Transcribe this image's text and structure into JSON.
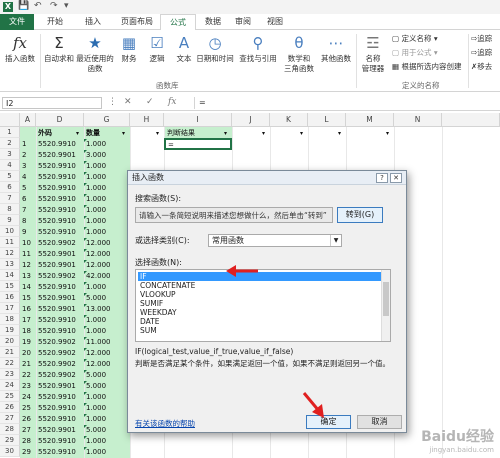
{
  "tabs": [
    "文件",
    "开始",
    "插入",
    "页面布局",
    "公式",
    "数据",
    "审阅",
    "视图"
  ],
  "ribbon": {
    "insert_function": "插入函数",
    "autosum": "自动求和",
    "recent": [
      "最近使用的",
      "函数"
    ],
    "financial": "财务",
    "logical": "逻辑",
    "text": "文本",
    "datetime": "日期和时间",
    "lookup": "查找与引用",
    "math": [
      "数学和",
      "三角函数"
    ],
    "other": "其他函数",
    "group_library": "函数库",
    "name_manager": [
      "名称",
      "管理器"
    ],
    "define_name": "定义名称",
    "use_in_formula": "用于公式",
    "create_from_selection": "根据所选内容创建",
    "group_defined_names": "定义的名称",
    "trace_precedents": "追踪",
    "trace_dependents": "追踪",
    "remove_arrows": "移去"
  },
  "formula_bar": {
    "name_box": "I2",
    "content": "="
  },
  "columns": [
    "A",
    "D",
    "G",
    "H",
    "I",
    "J",
    "K",
    "L",
    "M",
    "N"
  ],
  "header_row": {
    "col_d": "外码",
    "col_g": "数量",
    "col_i": "判断结果"
  },
  "rows": [
    {
      "n": "1",
      "a": "",
      "d": "",
      "g": ""
    },
    {
      "n": "2",
      "a": "1",
      "d": "5520.9910",
      "g": "1.000",
      "i": "="
    },
    {
      "n": "3",
      "a": "2",
      "d": "5520.9901",
      "g": "3.000"
    },
    {
      "n": "4",
      "a": "3",
      "d": "5520.9910",
      "g": "1.000"
    },
    {
      "n": "5",
      "a": "4",
      "d": "5520.9910",
      "g": "1.000"
    },
    {
      "n": "6",
      "a": "5",
      "d": "5520.9910",
      "g": "1.000"
    },
    {
      "n": "7",
      "a": "6",
      "d": "5520.9910",
      "g": "1.000"
    },
    {
      "n": "8",
      "a": "7",
      "d": "5520.9910",
      "g": "1.000"
    },
    {
      "n": "9",
      "a": "8",
      "d": "5520.9910",
      "g": "1.000"
    },
    {
      "n": "10",
      "a": "9",
      "d": "5520.9910",
      "g": "1.000"
    },
    {
      "n": "11",
      "a": "10",
      "d": "5520.9902",
      "g": "12.000"
    },
    {
      "n": "12",
      "a": "11",
      "d": "5520.9901",
      "g": "12.000"
    },
    {
      "n": "13",
      "a": "12",
      "d": "5520.9901",
      "g": "12.000"
    },
    {
      "n": "14",
      "a": "13",
      "d": "5520.9902",
      "g": "42.000"
    },
    {
      "n": "15",
      "a": "14",
      "d": "5520.9910",
      "g": "1.000"
    },
    {
      "n": "16",
      "a": "15",
      "d": "5520.9901",
      "g": "5.000"
    },
    {
      "n": "17",
      "a": "16",
      "d": "5520.9901",
      "g": "13.000"
    },
    {
      "n": "18",
      "a": "17",
      "d": "5520.9910",
      "g": "1.000"
    },
    {
      "n": "19",
      "a": "18",
      "d": "5520.9910",
      "g": "1.000"
    },
    {
      "n": "20",
      "a": "19",
      "d": "5520.9902",
      "g": "11.000"
    },
    {
      "n": "21",
      "a": "20",
      "d": "5520.9902",
      "g": "12.000"
    },
    {
      "n": "22",
      "a": "21",
      "d": "5520.9902",
      "g": "12.000"
    },
    {
      "n": "23",
      "a": "22",
      "d": "5520.9902",
      "g": "5.000"
    },
    {
      "n": "24",
      "a": "23",
      "d": "5520.9901",
      "g": "5.000"
    },
    {
      "n": "25",
      "a": "24",
      "d": "5520.9910",
      "g": "1.000"
    },
    {
      "n": "26",
      "a": "25",
      "d": "5520.9910",
      "g": "1.000"
    },
    {
      "n": "27",
      "a": "26",
      "d": "5520.9910",
      "g": "1.000"
    },
    {
      "n": "28",
      "a": "27",
      "d": "5520.9901",
      "g": "5.000"
    },
    {
      "n": "29",
      "a": "28",
      "d": "5520.9910",
      "g": "1.000"
    },
    {
      "n": "30",
      "a": "29",
      "d": "5520.9910",
      "g": "1.000"
    }
  ],
  "dialog": {
    "title": "插入函数",
    "search_label": "搜索函数(S):",
    "search_placeholder": "请输入一条简短说明来描述您想做什么，然后单击“转到”",
    "goto": "转到(G)",
    "category_label": "或选择类别(C):",
    "category_value": "常用函数",
    "select_label": "选择函数(N):",
    "functions": [
      "IF",
      "CONCATENATE",
      "VLOOKUP",
      "SUMIF",
      "WEEKDAY",
      "DATE",
      "SUM"
    ],
    "syntax": "IF(logical_test,value_if_true,value_if_false)",
    "description": "判断是否满足某个条件，如果满足返回一个值，如果不满足则返回另一个值。",
    "help_link": "有关该函数的帮助",
    "ok": "确定",
    "cancel": "取消"
  },
  "watermark": "Baidu经验",
  "watermark_sub": "jingyan.baidu.com",
  "colors": {
    "excel_green": "#217346",
    "highlight": "#c6efce",
    "select_blue": "#3399ff",
    "arrow_red": "#e02020"
  }
}
